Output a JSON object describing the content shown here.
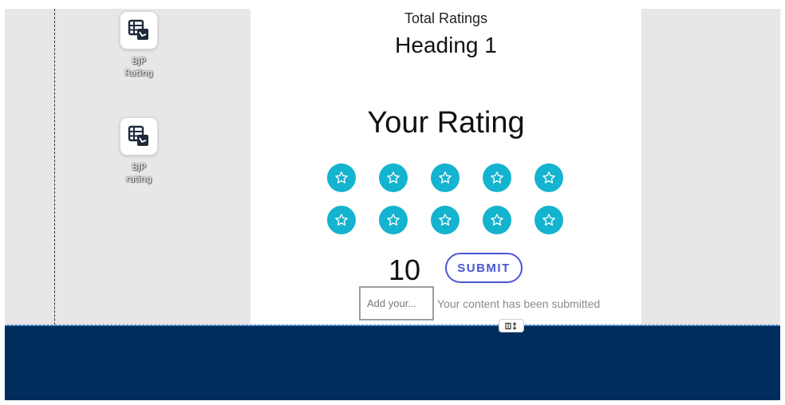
{
  "desktop_icons": [
    {
      "label_line1": "BJP",
      "label_line2": "Rating",
      "icon": "table-chart-icon"
    },
    {
      "label_line1": "BJP",
      "label_line2": "rating",
      "icon": "table-chart-icon"
    }
  ],
  "widget": {
    "total_ratings_label": "Total Ratings",
    "heading": "Heading 1",
    "your_rating_title": "Your Rating",
    "star_icon": "star-outline-icon",
    "star_count": 10,
    "rating_value": "10",
    "submit_label": "SUBMIT",
    "input_placeholder": "Add your...",
    "success_message": "Your content has been submitted"
  },
  "colors": {
    "star_fill": "#14b3cf",
    "submit_accent": "#4a56d6",
    "footer_strip": "#002d5e",
    "canvas": "#e8e6e6"
  },
  "resize_handle": {
    "icon": "resize-handle-icon"
  }
}
